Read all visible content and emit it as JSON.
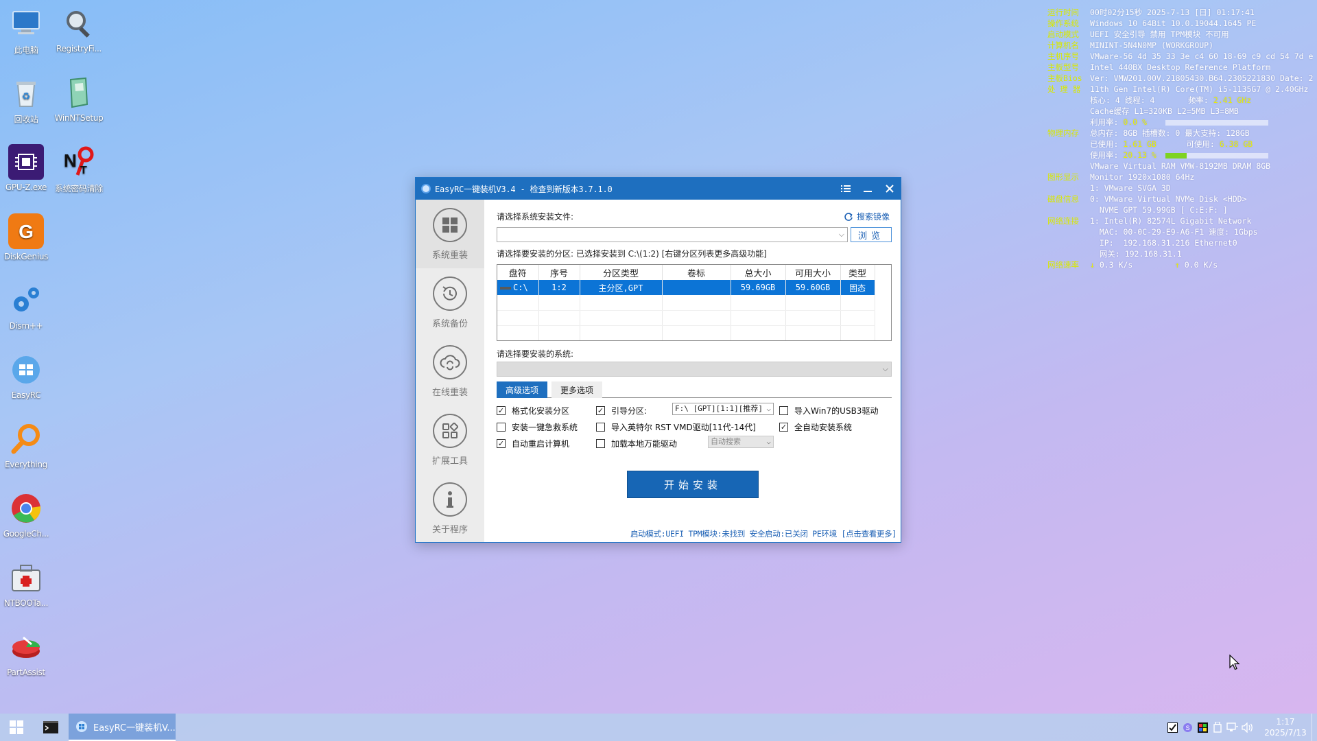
{
  "desktop": {
    "icons": [
      {
        "label": "此电脑"
      },
      {
        "label": "RegistryFi..."
      },
      {
        "label": "回收站"
      },
      {
        "label": "WinNTSetup"
      },
      {
        "label": "GPU-Z.exe"
      },
      {
        "label": "系统密码清除"
      },
      {
        "label": "DiskGenius"
      },
      {
        "label": "Dism++"
      },
      {
        "label": "EasyRC"
      },
      {
        "label": "Everything"
      },
      {
        "label": "GoogleCh..."
      },
      {
        "label": "NTBOOTa..."
      },
      {
        "label": "PartAssist"
      }
    ]
  },
  "sysinfo": {
    "runtime_k": "运行时间",
    "runtime_v": "00时02分15秒 2025-7-13 [日] 01:17:41",
    "os_k": "操作系统",
    "os_v": "Windows 10 64Bit 10.0.19044.1645 PE",
    "boot_k": "启动模式",
    "boot_v": "UEFI   安全引导  禁用   TPM模块  不可用",
    "pc_k": "计算机名",
    "pc_v": "MININT-5N4N0MP (WORKGROUP)",
    "mb_sn_k": "主机序号",
    "mb_sn_v": "VMware-56 4d 35 33 3e c4 60 18-69 c9 cd 54 7d e",
    "mb_model_k": "主板型号",
    "mb_model_v": "Intel 440BX Desktop Reference Platform",
    "bios_k": "主板Bios",
    "bios_v": "Ver: VMW201.00V.21805430.B64.2305221830 Date: 2",
    "cpu_k": "处 理 器",
    "cpu_v": "11th Gen Intel(R) Core(TM) i5-1135G7 @ 2.40GHz",
    "cpu_cores": "核心: 4  线程: 4",
    "cpu_freq_k": "频率:",
    "cpu_freq_v": "2.41 GHz",
    "cpu_cache": "Cache缓存 L1=320KB  L2=5MB  L3=8MB",
    "cpu_use_k": "利用率:",
    "cpu_use_v": "0.0 %",
    "cpu_use_pct": 0,
    "mem_k": "物理内存",
    "mem_v": "总内存: 8GB  插槽数: 0  最大支持: 128GB",
    "mem_used_k": "已使用:",
    "mem_used_v": "1.61 GB",
    "mem_avail_k": "可使用:",
    "mem_avail_v": "6.38 GB",
    "mem_use_k": "使用率:",
    "mem_use_v": "20.13 %",
    "mem_use_pct": 20.13,
    "mem_dram": "VMware Virtual RAM VMW-8192MB DRAM 8GB",
    "gpu_k": "图形显示",
    "gpu_v": "Monitor 1920x1080 64Hz",
    "gpu_v2": "1: VMware SVGA 3D",
    "disk_k": "磁盘信息",
    "disk_v": "0: VMware Virtual NVMe Disk <HDD>",
    "disk_v2": "  NVME GPT 59.99GB [ C:E:F: ]",
    "net_k": "网络连接",
    "net_v": "1: Intel(R) 82574L Gigabit Network",
    "net_mac": "  MAC: 00-0C-29-E9-A6-F1 速度: 1Gbps",
    "net_ip": "  IP:  192.168.31.216 Ethernet0",
    "net_gw": "  网关: 192.168.31.1",
    "speed_k": "网络速率",
    "speed_down_arrow": "↓",
    "speed_down": "0.3 K/s",
    "speed_up_arrow": "↑",
    "speed_up": "0.0 K/s"
  },
  "window": {
    "title": "EasyRC一键装机V3.4 - 检查到新版本3.7.1.0",
    "sidebar": [
      {
        "label": "系统重装"
      },
      {
        "label": "系统备份"
      },
      {
        "label": "在线重装"
      },
      {
        "label": "扩展工具"
      },
      {
        "label": "关于程序"
      }
    ],
    "select_file_label": "请选择系统安装文件:",
    "search_image_link": "搜索镜像",
    "file_combo_value": "",
    "browse_button": "浏览",
    "partition_label": "请选择要安装的分区: 已选择安装到 C:\\(1:2) [右键分区列表更多高级功能]",
    "table": {
      "headers": [
        "盘符",
        "序号",
        "分区类型",
        "卷标",
        "总大小",
        "可用大小",
        "类型"
      ],
      "rows": [
        [
          "C:\\",
          "1:2",
          "主分区,GPT",
          "",
          "59.69GB",
          "59.60GB",
          "固态"
        ]
      ]
    },
    "select_system_label": "请选择要安装的系统:",
    "system_combo_value": "",
    "tabs": [
      "高级选项",
      "更多选项"
    ],
    "options": {
      "format": "格式化安装分区",
      "boot_partition": "引导分区:",
      "boot_partition_value": "F:\\ [GPT][1:1][推荐]",
      "win7_usb3": "导入Win7的USB3驱动",
      "emergency": "安装一键急救系统",
      "intel_vmd": "导入英特尔 RST VMD驱动[11代-14代]",
      "auto_install": "全自动安装系统",
      "auto_reboot": "自动重启计算机",
      "local_driver": "加载本地万能驱动",
      "local_driver_value": "自动搜索"
    },
    "checks": {
      "format": true,
      "boot_partition": true,
      "win7_usb3": false,
      "emergency": false,
      "intel_vmd": false,
      "auto_install": true,
      "auto_reboot": true,
      "local_driver": false
    },
    "start_button": "开始安装",
    "status_bar": "启动模式:UEFI TPM模块:未找到 安全启动:已关闭 PE环境 [点击查看更多]"
  },
  "taskbar": {
    "app_label": "EasyRC一键装机V...",
    "clock_time": "1:17",
    "clock_date": "2025/7/13"
  },
  "colors": {
    "accent": "#1e6fbf",
    "selection": "#0c74d6",
    "sysinfo_key": "#d8e800"
  }
}
